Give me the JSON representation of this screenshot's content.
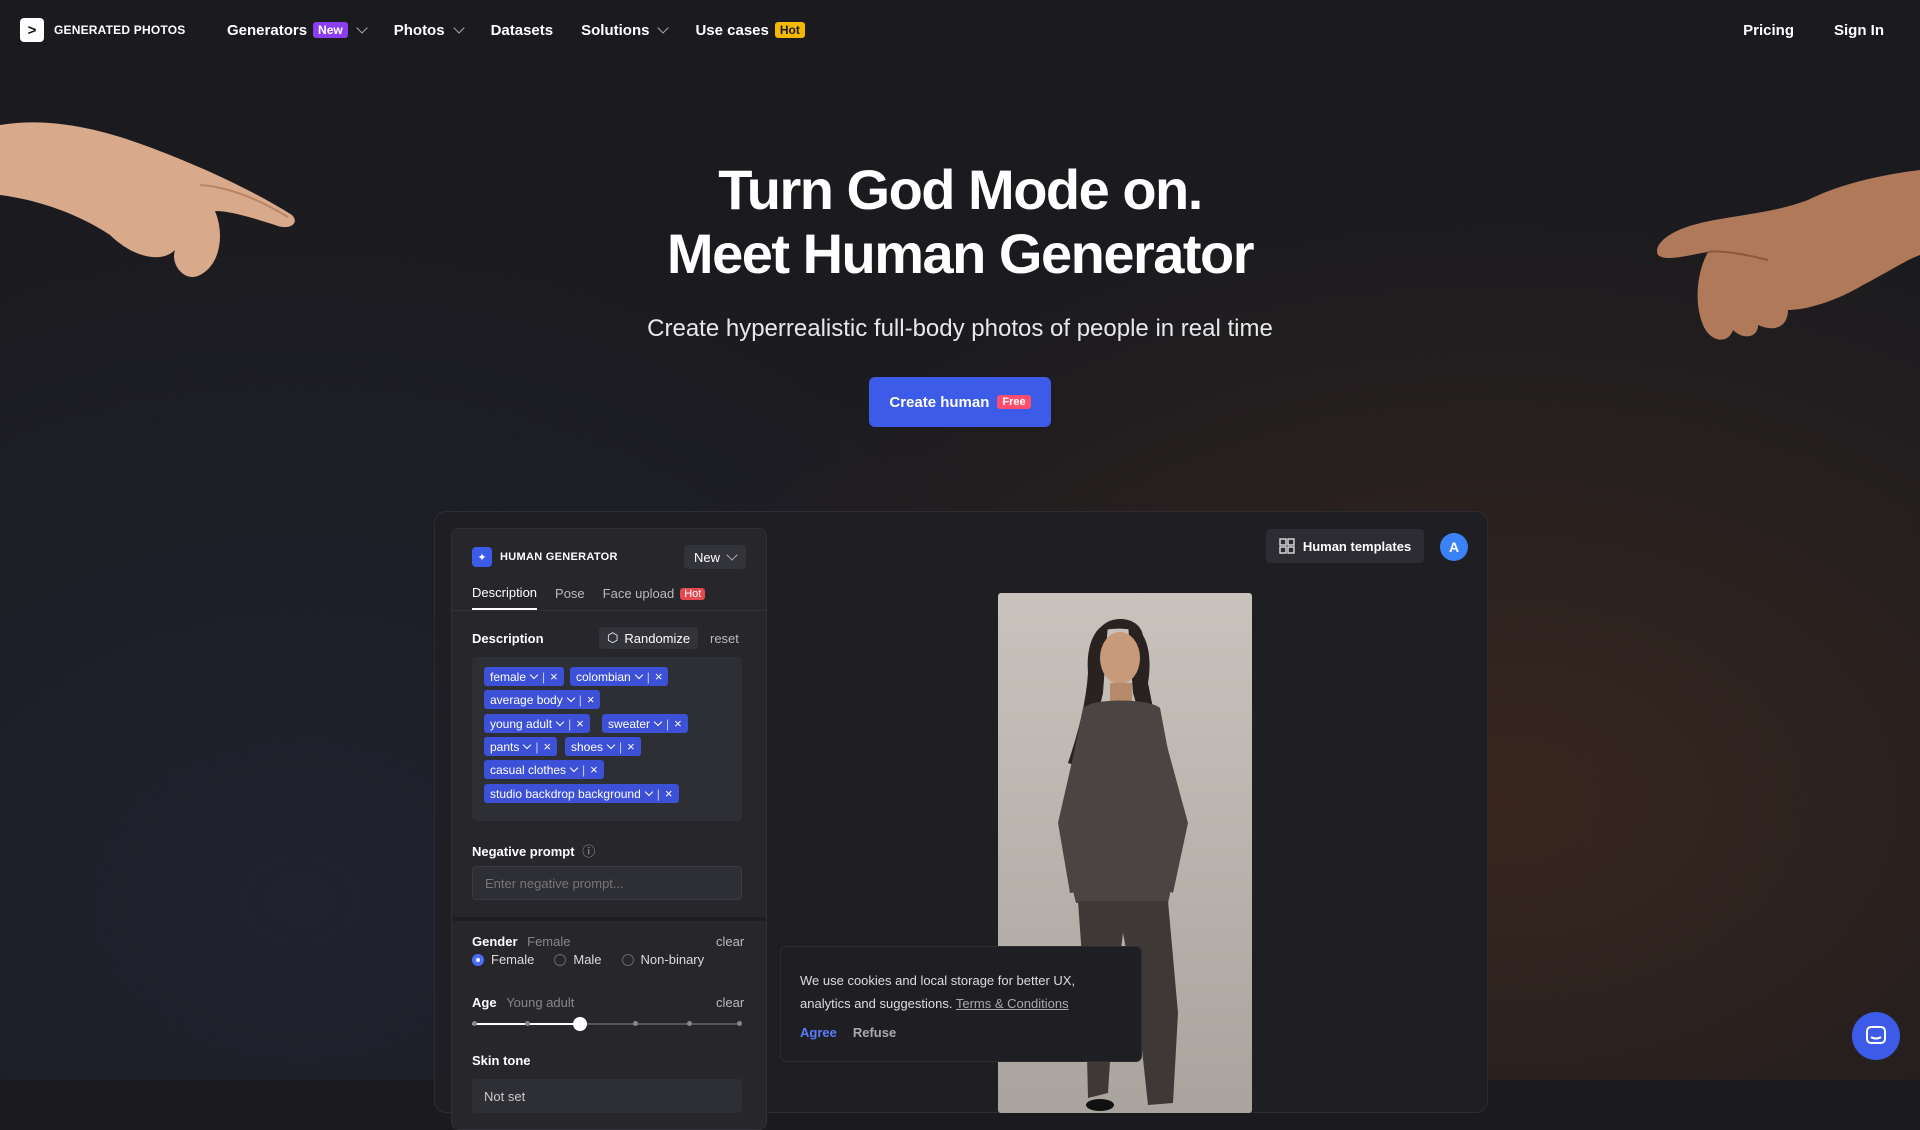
{
  "brand": {
    "name": "GENERATED PHOTOS",
    "mark": ">"
  },
  "nav": {
    "items": [
      {
        "label": "Generators",
        "badge": "New"
      },
      {
        "label": "Photos"
      },
      {
        "label": "Datasets"
      },
      {
        "label": "Solutions"
      },
      {
        "label": "Use cases",
        "badge": "Hot"
      }
    ],
    "pricing": "Pricing",
    "signin": "Sign In"
  },
  "hero": {
    "title_line1": "Turn God Mode on.",
    "title_line2": "Meet Human Generator",
    "subtitle": "Create hyperrealistic full-body photos of people in real time",
    "cta_label": "Create human",
    "cta_badge": "Free"
  },
  "app": {
    "panel_title": "HUMAN GENERATOR",
    "new_label": "New",
    "tabs": [
      {
        "label": "Description"
      },
      {
        "label": "Pose"
      },
      {
        "label": "Face upload",
        "badge": "Hot"
      }
    ],
    "description_label": "Description",
    "randomize_label": "Randomize",
    "reset_label": "reset",
    "tags": [
      "female",
      "colombian",
      "average body",
      "young adult",
      "sweater",
      "pants",
      "shoes",
      "casual clothes",
      "studio backdrop background"
    ],
    "negative_label": "Negative prompt",
    "negative_placeholder": "Enter negative prompt...",
    "gender_label": "Gender",
    "gender_value": "Female",
    "clear_label": "clear",
    "gender_options": [
      "Female",
      "Male",
      "Non-binary"
    ],
    "age_label": "Age",
    "age_value": "Young adult",
    "age_slider_position": 0.4,
    "skin_label": "Skin tone",
    "skin_value": "Not set",
    "templates_label": "Human templates",
    "avatar_letter": "A"
  },
  "cookie": {
    "text": "We use cookies and local storage for better UX, analytics and suggestions.",
    "link": "Terms & Conditions",
    "agree": "Agree",
    "refuse": "Refuse"
  }
}
